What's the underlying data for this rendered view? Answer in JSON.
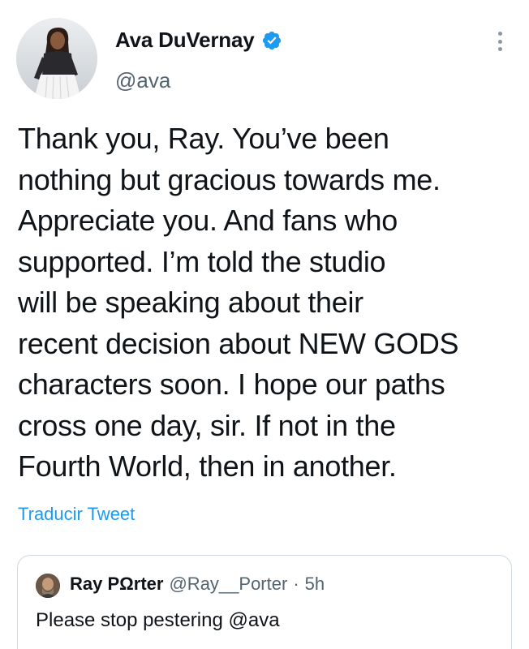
{
  "author": {
    "display_name": "Ava DuVernay",
    "handle": "@ava",
    "verified": true
  },
  "tweet": {
    "text": "Thank you, Ray. You’ve been\nnothing but gracious towards me.\nAppreciate you. And fans who\nsupported. I’m told the studio\nwill be speaking about their\nrecent decision about NEW GODS\ncharacters soon. I hope our paths\ncross one day, sir. If not in the\nFourth World, then in another.",
    "translate_label": "Traducir Tweet"
  },
  "quoted_tweet": {
    "display_name": "Ray PΩrter",
    "handle": "@Ray__Porter",
    "separator": "·",
    "time": "5h",
    "text": "Please stop pestering @ava"
  },
  "icons": {
    "verified": "verified-badge-icon",
    "more": "more-options-icon"
  },
  "colors": {
    "accent": "#1d9bf0",
    "text": "#0f1419",
    "secondary": "#536471",
    "border": "#cfd9de"
  }
}
